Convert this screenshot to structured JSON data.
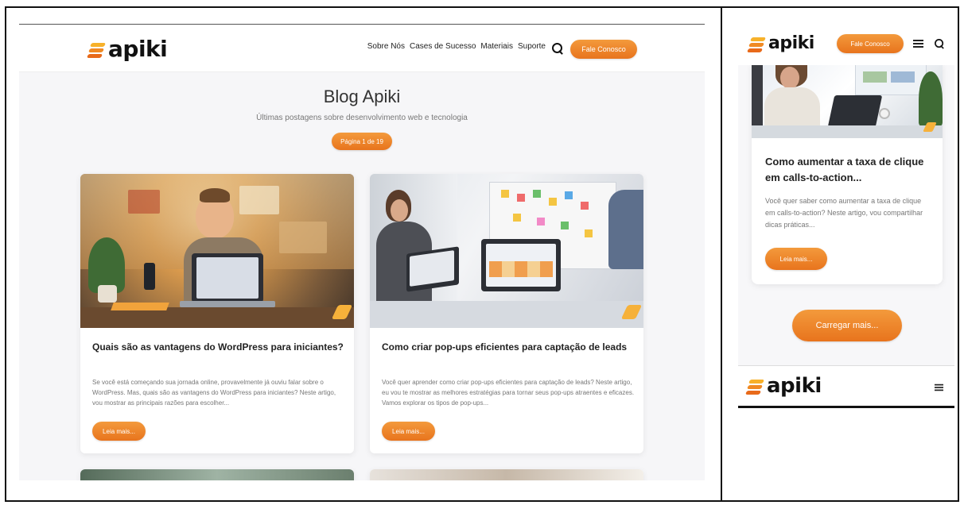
{
  "desktop": {
    "logo": "apiki",
    "nav": [
      "Sobre Nós",
      "Cases de Sucesso",
      "Materiais",
      "Suporte"
    ],
    "cta": "Fale Conosco",
    "title": "Blog Apiki",
    "subtitle": "Últimas postagens sobre desenvolvimento web e tecnologia",
    "page_badge": "Página 1 de 19",
    "posts": [
      {
        "title": "Quais são as vantagens do WordPress para iniciantes?",
        "excerpt": "Se você está começando sua jornada online, provavelmente já ouviu falar sobre o WordPress. Mas, quais são as vantagens do WordPress para iniciantes? Neste artigo, vou mostrar as principais razões para escolher...",
        "button": "Leia mais..."
      },
      {
        "title": "Como criar pop-ups eficientes para captação de leads",
        "excerpt": "Você quer aprender como criar pop-ups eficientes para captação de leads? Neste artigo, eu vou te mostrar as melhores estratégias para tornar seus pop-ups atraentes e eficazes. Vamos explorar os tipos de pop-ups...",
        "button": "Leia mais..."
      }
    ]
  },
  "mobile": {
    "logo": "apiki",
    "cta": "Fale Conosco",
    "post": {
      "title": "Como aumentar a taxa de clique em calls-to-action...",
      "excerpt": "Você quer saber como aumentar a taxa de clique em calls-to-action? Neste artigo, vou compartilhar dicas práticas...",
      "button": "Leia mais..."
    },
    "load_more": "Carregar mais...",
    "footer_logo": "apiki"
  },
  "colors": {
    "accent": "#f08a24",
    "accent_dark": "#e8741d",
    "background": "#f6f6f8",
    "text": "#222222",
    "muted": "#777777"
  },
  "icons": [
    "search-icon",
    "menu-icon"
  ]
}
